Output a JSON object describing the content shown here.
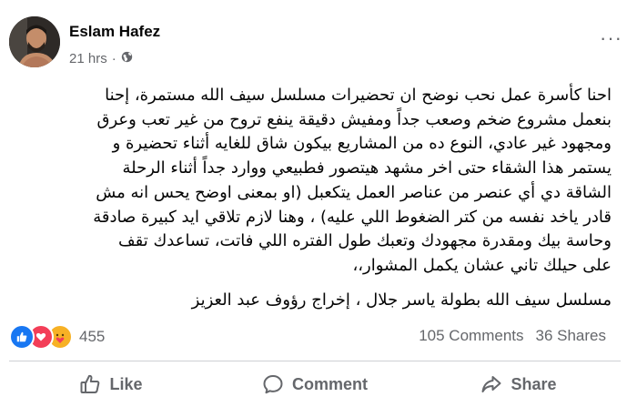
{
  "post": {
    "author": "Eslam Hafez",
    "time": "21 hrs",
    "separator": "·",
    "audience_icon": "globe-icon",
    "text_lines": [
      "احنا كأسرة عمل نحب نوضح ان تحضيرات مسلسل سيف الله مستمرة، إحنا",
      "بنعمل مشروع ضخم وصعب جداً ومفيش دقيقة ينفع تروح من غير تعب وعرق",
      "ومجهود غير عادي، النوع ده من المشاريع بيكون شاق للغايه أثناء تحضيرة و",
      "يستمر هذا الشقاء حتى اخر مشهد هيتصور فطبيعي ووارد جداً أثناء الرحلة",
      "الشاقة دي أي عنصر من عناصر العمل يتكعبل (او بمعنى اوضح يحس انه مش",
      "قادر ياخد نفسه من كتر الضغوط اللي عليه) ، وهنا لازم تلاقي ايد كبيرة صادقة",
      "وحاسة بيك ومقدرة مجهودك وتعبك طول الفتره اللي فاتت، تساعدك تقف",
      "على حيلك تاني عشان يكمل المشوار،،"
    ],
    "credit": "مسلسل سيف الله بطولة ياسر جلال ، إخراج رؤوف عبد العزيز"
  },
  "stats": {
    "reactions": [
      "like",
      "love",
      "care"
    ],
    "reaction_count": "455",
    "comments": "105 Comments",
    "shares": "36 Shares"
  },
  "actions": {
    "like": "Like",
    "comment": "Comment",
    "share": "Share"
  },
  "colors": {
    "like_blue": "#1877f2",
    "love_red": "#f33e58",
    "care_yellow": "#f7b125",
    "secondary_text": "#65676b"
  }
}
